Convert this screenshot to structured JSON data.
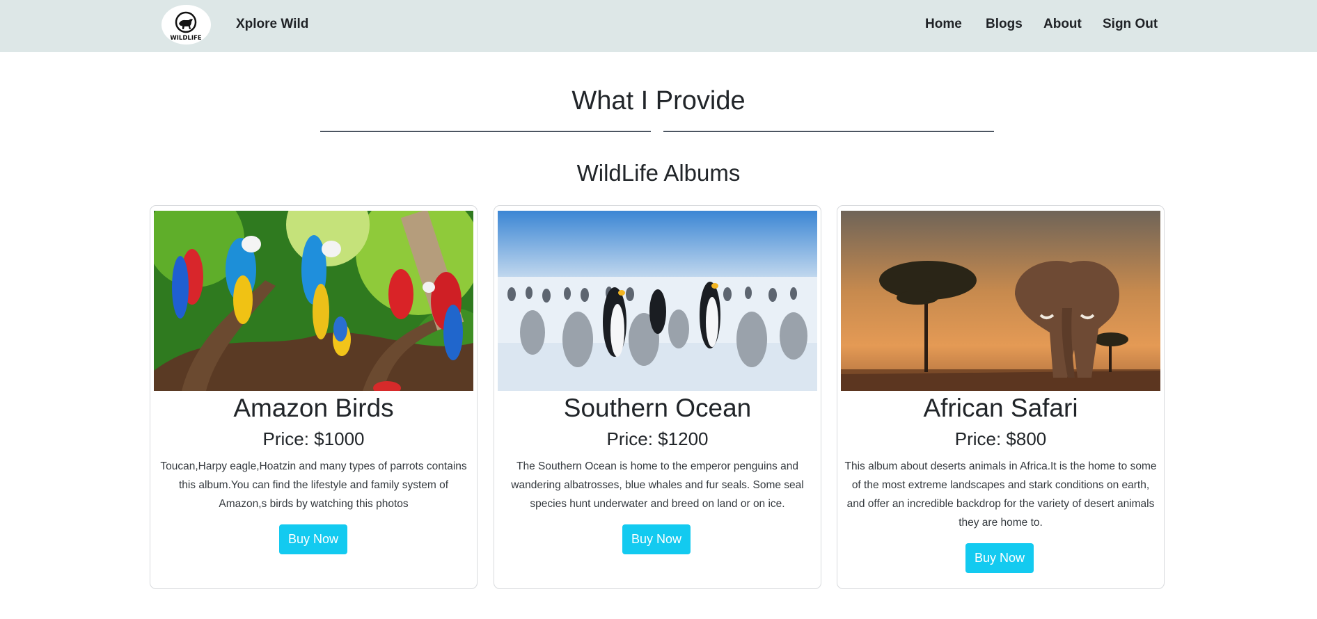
{
  "navbar": {
    "logo_text": "WILDLIFE",
    "brand": "Xplore Wild",
    "links": [
      "Home",
      "Blogs",
      "About",
      "Sign Out"
    ]
  },
  "main": {
    "section_title": "What I Provide",
    "albums_title": "WildLife Albums"
  },
  "albums": [
    {
      "title": "Amazon Birds",
      "price": "Price: $1000",
      "description": "Toucan,Harpy eagle,Hoatzin and many types of parrots contains this album.You can find the lifestyle and family system of Amazon,s birds by watching this photos",
      "button": "Buy Now"
    },
    {
      "title": "Southern Ocean",
      "price": "Price: $1200",
      "description": "The Southern Ocean is home to the emperor penguins and wandering albatrosses, blue whales and fur seals. Some seal species hunt underwater and breed on land or on ice.",
      "button": "Buy Now"
    },
    {
      "title": "African Safari",
      "price": "Price: $800",
      "description": "This album about deserts animals in Africa.It is the home to some of the most extreme landscapes and stark conditions on earth, and offer an incredible backdrop for the variety of desert animals they are home to.",
      "button": "Buy Now"
    }
  ],
  "colors": {
    "navbar_bg": "#dde7e7",
    "button_bg": "#13caf0",
    "button_text": "#ffffff"
  }
}
